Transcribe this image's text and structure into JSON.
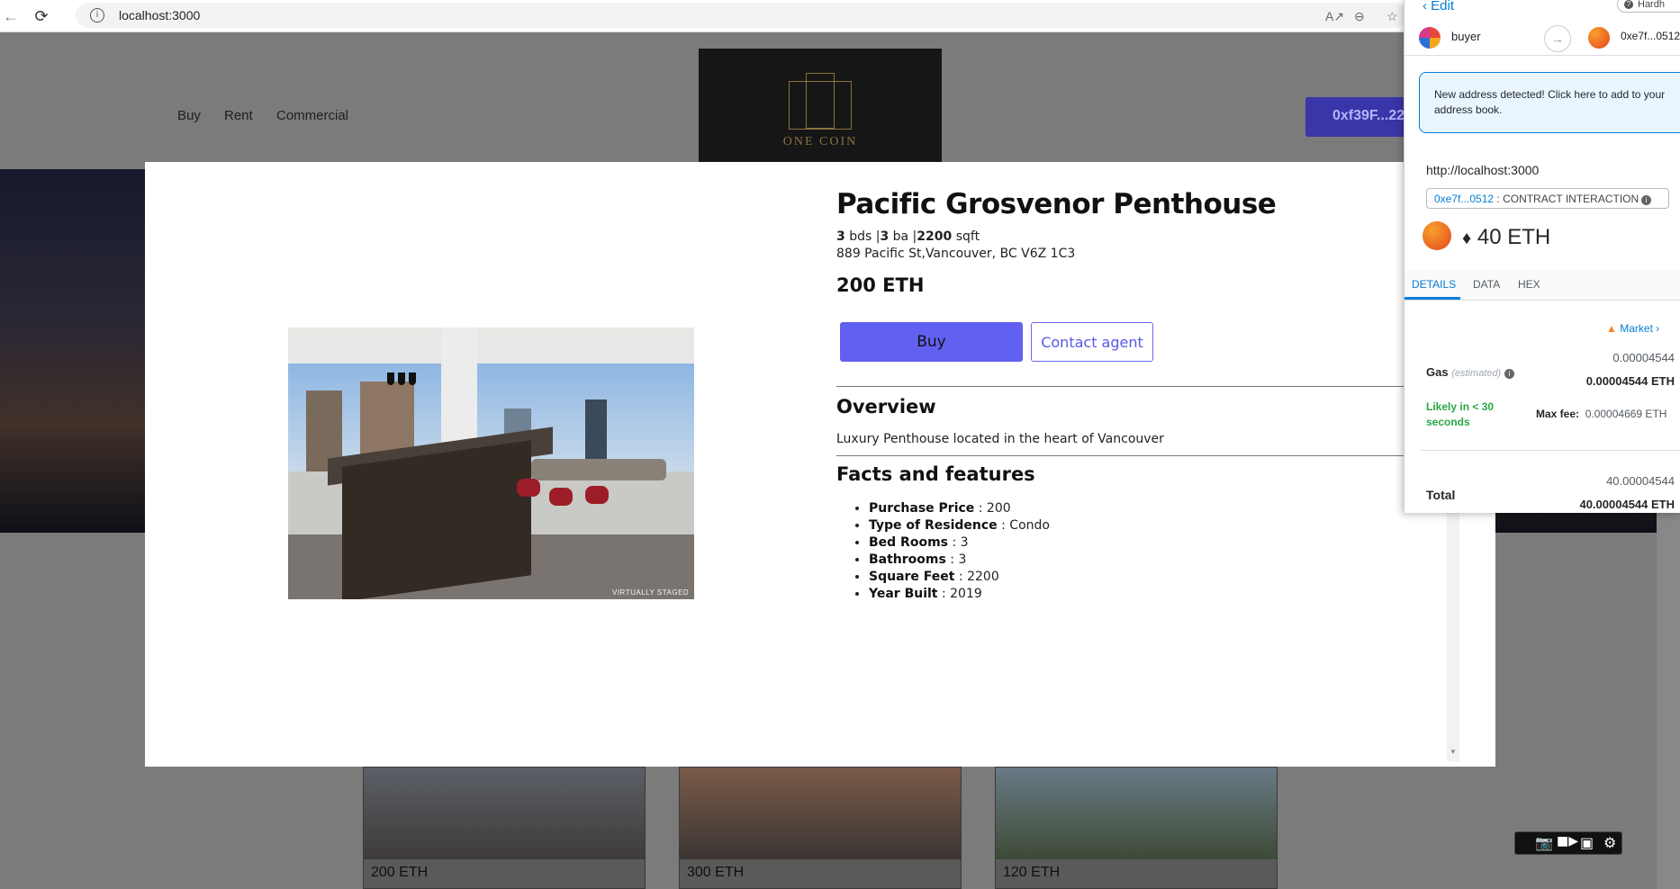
{
  "browser": {
    "url": "localhost:3000",
    "back_icon": "back-arrow-icon",
    "reload_icon": "reload-icon",
    "info_icon": "info-icon",
    "tools": [
      "read-aloud-icon",
      "zoom-out-icon",
      "favorite-icon"
    ]
  },
  "site": {
    "nav": [
      "Buy",
      "Rent",
      "Commercial"
    ],
    "logo_text": "ONE COIN",
    "wallet_button": "0xf39F...22",
    "cards": [
      {
        "price": "200 ETH"
      },
      {
        "price": "300 ETH"
      },
      {
        "price": "120 ETH"
      }
    ]
  },
  "modal": {
    "title": "Pacific Grosvenor Penthouse",
    "specs": {
      "beds": "3",
      "beds_unit": " bds |",
      "baths": "3",
      "baths_unit": " ba |",
      "sqft": "2200",
      "sqft_unit": " sqft"
    },
    "address": "889 Pacific St,Vancouver, BC V6Z 1C3",
    "price": "200 ETH",
    "buy_label": "Buy",
    "contact_label": "Contact agent",
    "overview_heading": "Overview",
    "overview_text": "Luxury Penthouse located in the heart of Vancouver",
    "facts_heading": "Facts and features",
    "facts": [
      {
        "label": "Purchase Price",
        "value": " : 200"
      },
      {
        "label": "Type of Residence",
        "value": " : Condo"
      },
      {
        "label": "Bed Rooms",
        "value": " : 3"
      },
      {
        "label": "Bathrooms",
        "value": " : 3"
      },
      {
        "label": "Square Feet",
        "value": " : 2200"
      },
      {
        "label": "Year Built",
        "value": " : 2019"
      }
    ],
    "photo_stamp": "VIRTUALLY STAGED"
  },
  "metamask": {
    "edit_label": "Edit",
    "network_label": "Hardh",
    "from_account": "buyer",
    "to_account": "0xe7f...0512",
    "alert_text": "New address detected! Click here to add to your address book.",
    "origin": "http://localhost:3000",
    "contract_address": "0xe7f...0512",
    "contract_label": " : CONTRACT INTERACTION",
    "value": "40 ETH",
    "tabs": [
      "DETAILS",
      "DATA",
      "HEX"
    ],
    "market_label": "Market",
    "gas_label": "Gas",
    "gas_estimated": "(estimated)",
    "gas_fiat": "0.00004544",
    "gas_eth": "0.00004544 ETH",
    "likely_text": "Likely in < 30 seconds",
    "max_fee_label": "Max fee:",
    "max_fee_value": "0.00004669 ETH",
    "total_label": "Total",
    "total_fiat": "40.00004544",
    "total_eth": "40.00004544 ETH"
  },
  "recorder": [
    "camera-icon",
    "video-icon",
    "screen-icon",
    "settings-icon"
  ],
  "colors": {
    "accent": "#6260f0",
    "metamask_blue": "#037dd6",
    "success": "#28a745"
  }
}
